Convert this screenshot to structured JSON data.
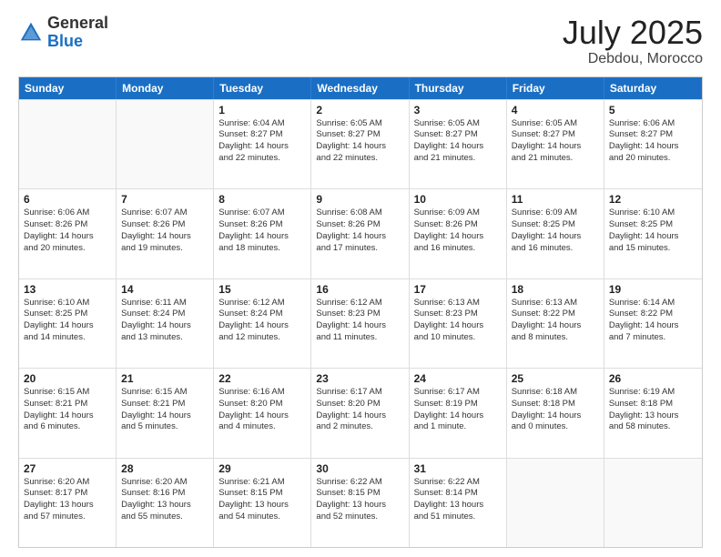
{
  "header": {
    "logo_general": "General",
    "logo_blue": "Blue",
    "month": "July 2025",
    "location": "Debdou, Morocco"
  },
  "weekdays": [
    "Sunday",
    "Monday",
    "Tuesday",
    "Wednesday",
    "Thursday",
    "Friday",
    "Saturday"
  ],
  "rows": [
    [
      {
        "day": "",
        "lines": [],
        "empty": true
      },
      {
        "day": "",
        "lines": [],
        "empty": true
      },
      {
        "day": "1",
        "lines": [
          "Sunrise: 6:04 AM",
          "Sunset: 8:27 PM",
          "Daylight: 14 hours",
          "and 22 minutes."
        ]
      },
      {
        "day": "2",
        "lines": [
          "Sunrise: 6:05 AM",
          "Sunset: 8:27 PM",
          "Daylight: 14 hours",
          "and 22 minutes."
        ]
      },
      {
        "day": "3",
        "lines": [
          "Sunrise: 6:05 AM",
          "Sunset: 8:27 PM",
          "Daylight: 14 hours",
          "and 21 minutes."
        ]
      },
      {
        "day": "4",
        "lines": [
          "Sunrise: 6:05 AM",
          "Sunset: 8:27 PM",
          "Daylight: 14 hours",
          "and 21 minutes."
        ]
      },
      {
        "day": "5",
        "lines": [
          "Sunrise: 6:06 AM",
          "Sunset: 8:27 PM",
          "Daylight: 14 hours",
          "and 20 minutes."
        ]
      }
    ],
    [
      {
        "day": "6",
        "lines": [
          "Sunrise: 6:06 AM",
          "Sunset: 8:26 PM",
          "Daylight: 14 hours",
          "and 20 minutes."
        ]
      },
      {
        "day": "7",
        "lines": [
          "Sunrise: 6:07 AM",
          "Sunset: 8:26 PM",
          "Daylight: 14 hours",
          "and 19 minutes."
        ]
      },
      {
        "day": "8",
        "lines": [
          "Sunrise: 6:07 AM",
          "Sunset: 8:26 PM",
          "Daylight: 14 hours",
          "and 18 minutes."
        ]
      },
      {
        "day": "9",
        "lines": [
          "Sunrise: 6:08 AM",
          "Sunset: 8:26 PM",
          "Daylight: 14 hours",
          "and 17 minutes."
        ]
      },
      {
        "day": "10",
        "lines": [
          "Sunrise: 6:09 AM",
          "Sunset: 8:26 PM",
          "Daylight: 14 hours",
          "and 16 minutes."
        ]
      },
      {
        "day": "11",
        "lines": [
          "Sunrise: 6:09 AM",
          "Sunset: 8:25 PM",
          "Daylight: 14 hours",
          "and 16 minutes."
        ]
      },
      {
        "day": "12",
        "lines": [
          "Sunrise: 6:10 AM",
          "Sunset: 8:25 PM",
          "Daylight: 14 hours",
          "and 15 minutes."
        ]
      }
    ],
    [
      {
        "day": "13",
        "lines": [
          "Sunrise: 6:10 AM",
          "Sunset: 8:25 PM",
          "Daylight: 14 hours",
          "and 14 minutes."
        ]
      },
      {
        "day": "14",
        "lines": [
          "Sunrise: 6:11 AM",
          "Sunset: 8:24 PM",
          "Daylight: 14 hours",
          "and 13 minutes."
        ]
      },
      {
        "day": "15",
        "lines": [
          "Sunrise: 6:12 AM",
          "Sunset: 8:24 PM",
          "Daylight: 14 hours",
          "and 12 minutes."
        ]
      },
      {
        "day": "16",
        "lines": [
          "Sunrise: 6:12 AM",
          "Sunset: 8:23 PM",
          "Daylight: 14 hours",
          "and 11 minutes."
        ]
      },
      {
        "day": "17",
        "lines": [
          "Sunrise: 6:13 AM",
          "Sunset: 8:23 PM",
          "Daylight: 14 hours",
          "and 10 minutes."
        ]
      },
      {
        "day": "18",
        "lines": [
          "Sunrise: 6:13 AM",
          "Sunset: 8:22 PM",
          "Daylight: 14 hours",
          "and 8 minutes."
        ]
      },
      {
        "day": "19",
        "lines": [
          "Sunrise: 6:14 AM",
          "Sunset: 8:22 PM",
          "Daylight: 14 hours",
          "and 7 minutes."
        ]
      }
    ],
    [
      {
        "day": "20",
        "lines": [
          "Sunrise: 6:15 AM",
          "Sunset: 8:21 PM",
          "Daylight: 14 hours",
          "and 6 minutes."
        ]
      },
      {
        "day": "21",
        "lines": [
          "Sunrise: 6:15 AM",
          "Sunset: 8:21 PM",
          "Daylight: 14 hours",
          "and 5 minutes."
        ]
      },
      {
        "day": "22",
        "lines": [
          "Sunrise: 6:16 AM",
          "Sunset: 8:20 PM",
          "Daylight: 14 hours",
          "and 4 minutes."
        ]
      },
      {
        "day": "23",
        "lines": [
          "Sunrise: 6:17 AM",
          "Sunset: 8:20 PM",
          "Daylight: 14 hours",
          "and 2 minutes."
        ]
      },
      {
        "day": "24",
        "lines": [
          "Sunrise: 6:17 AM",
          "Sunset: 8:19 PM",
          "Daylight: 14 hours",
          "and 1 minute."
        ]
      },
      {
        "day": "25",
        "lines": [
          "Sunrise: 6:18 AM",
          "Sunset: 8:18 PM",
          "Daylight: 14 hours",
          "and 0 minutes."
        ]
      },
      {
        "day": "26",
        "lines": [
          "Sunrise: 6:19 AM",
          "Sunset: 8:18 PM",
          "Daylight: 13 hours",
          "and 58 minutes."
        ]
      }
    ],
    [
      {
        "day": "27",
        "lines": [
          "Sunrise: 6:20 AM",
          "Sunset: 8:17 PM",
          "Daylight: 13 hours",
          "and 57 minutes."
        ]
      },
      {
        "day": "28",
        "lines": [
          "Sunrise: 6:20 AM",
          "Sunset: 8:16 PM",
          "Daylight: 13 hours",
          "and 55 minutes."
        ]
      },
      {
        "day": "29",
        "lines": [
          "Sunrise: 6:21 AM",
          "Sunset: 8:15 PM",
          "Daylight: 13 hours",
          "and 54 minutes."
        ]
      },
      {
        "day": "30",
        "lines": [
          "Sunrise: 6:22 AM",
          "Sunset: 8:15 PM",
          "Daylight: 13 hours",
          "and 52 minutes."
        ]
      },
      {
        "day": "31",
        "lines": [
          "Sunrise: 6:22 AM",
          "Sunset: 8:14 PM",
          "Daylight: 13 hours",
          "and 51 minutes."
        ]
      },
      {
        "day": "",
        "lines": [],
        "empty": true
      },
      {
        "day": "",
        "lines": [],
        "empty": true
      }
    ]
  ]
}
